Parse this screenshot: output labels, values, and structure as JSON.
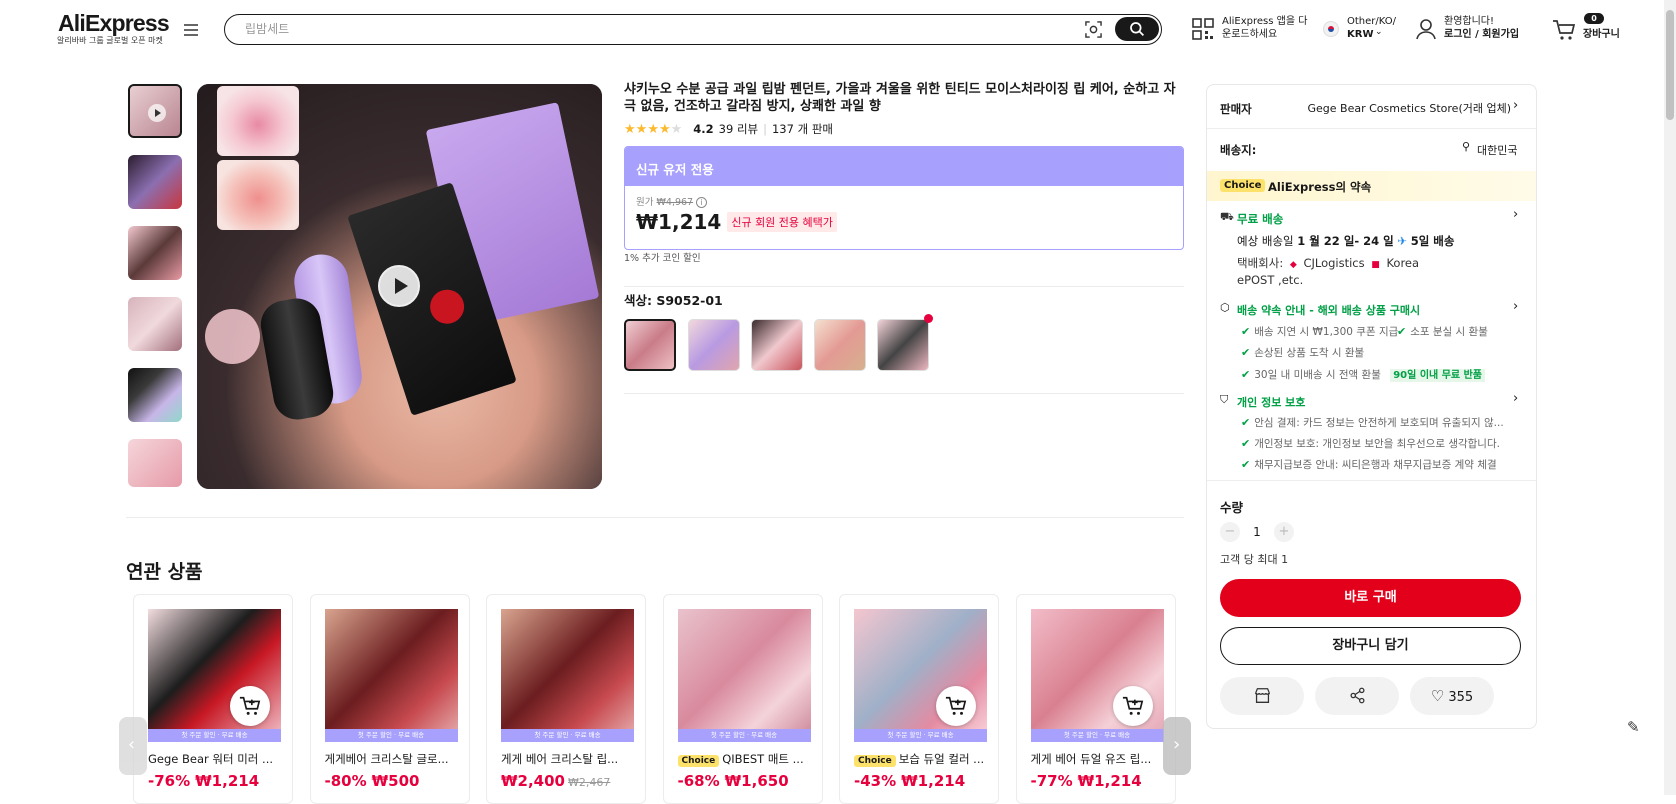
{
  "header": {
    "logo": "AliExpress",
    "logo_sub": "알리바바 그룹 글로벌 오픈 마켓",
    "search_placeholder": "립밤세트",
    "app_line1": "AliExpress 앱을 다",
    "app_line2": "운로드하세요",
    "region_line1": "Other/KO/",
    "region_line2": "KRW",
    "account_line1": "환영합니다!",
    "account_line2": "로그인 / 회원가입",
    "cart_count": "0",
    "cart_label": "장바구니"
  },
  "gallery": {
    "thumb_count": 6,
    "selected_index": 0
  },
  "product": {
    "title": "샤키누오 수분 공급 과일 립밤 펜던트, 가을과 겨울을 위한 틴티드 모이스처라이징 립 케어, 순하고 자극 없음, 건조하고 갈라짐 방지, 상쾌한 과일 향",
    "rating": "4.2",
    "reviews": "39 리뷰",
    "sold": "137 개 판매",
    "star_count": 4,
    "promo_header": "신규 유저 전용",
    "orig_label": "원가",
    "orig_price": "₩4,967",
    "price": "₩1,214",
    "new_member_badge": "신규 회원 전용 혜택가",
    "coin_note": "1% 추가 코인 할인",
    "color_label": "색상: S9052-01",
    "swatch_count": 5
  },
  "panel": {
    "seller_label": "판매자",
    "seller_name": "Gege Bear Cosmetics Store(거래 업체)",
    "ship_to_label": "배송지:",
    "ship_to": "대한민국",
    "choice_badge": "Choice",
    "choice_promise": "AliExpress의 약속",
    "free_ship": "무료 배송",
    "eta_prefix": "예상 배송일",
    "eta_dates": "1 월 22 일- 24 일",
    "eta_fast": "5일 배송",
    "carrier_label": "택배회사:",
    "carrier1": "CJLogistics",
    "carrier2": "Korea",
    "carrier3": "ePOST ,etc.",
    "guarantee_title": "배송 약속 안내 - 해외 배송 상품 구매시",
    "g1": "배송 지연 시 ₩1,300 쿠폰 지급",
    "g2": "소포 분실 시 환불",
    "g3": "손상된 상품 도착 시 환불",
    "g4": "30일 내 미배송 시 전액 환불",
    "g4_badge": "90일 이내 무료 반품",
    "privacy_title": "개인 정보 보호",
    "p1": "안심 결제: 카드 정보는 안전하게 보호되며 유출되지 않...",
    "p2": "개인정보 보호: 개인정보 보안을 최우선으로 생각합니다.",
    "p3": "채무지급보증 안내: 씨티은행과 채무지급보증 계약 체결",
    "qty_label": "수량",
    "qty_value": "1",
    "qty_limit": "고객 당 최대 1",
    "buy_now": "바로 구매",
    "add_cart": "장바구니 담기",
    "wishlist_count": "355"
  },
  "related": {
    "title": "연관 상품",
    "band": "첫 주문 할인 · 무료 배송",
    "items": [
      {
        "name": "Gege Bear 워터 미러 ...",
        "discount": "-76%",
        "price": "₩1,214",
        "orig": "",
        "choice": ""
      },
      {
        "name": "게게베어 크리스탈 글로...",
        "discount": "-80%",
        "price": "₩500",
        "orig": "",
        "choice": ""
      },
      {
        "name": "게게 베어 크리스탈 립...",
        "discount": "",
        "price": "₩2,400",
        "orig": "₩2,467",
        "choice": ""
      },
      {
        "name": "QIBEST 매트 ...",
        "discount": "-68%",
        "price": "₩1,650",
        "orig": "",
        "choice": "Choice"
      },
      {
        "name": "보습 듀얼 컬러 ...",
        "discount": "-43%",
        "price": "₩1,214",
        "orig": "",
        "choice": "Choice"
      },
      {
        "name": "게게 베어 듀얼 유즈 립...",
        "discount": "-77%",
        "price": "₩1,214",
        "orig": "",
        "choice": ""
      }
    ]
  },
  "colors": {
    "accent": "#e6003d",
    "promo": "#a7a0fc",
    "green": "#00a046",
    "buy": "#e2001a"
  }
}
